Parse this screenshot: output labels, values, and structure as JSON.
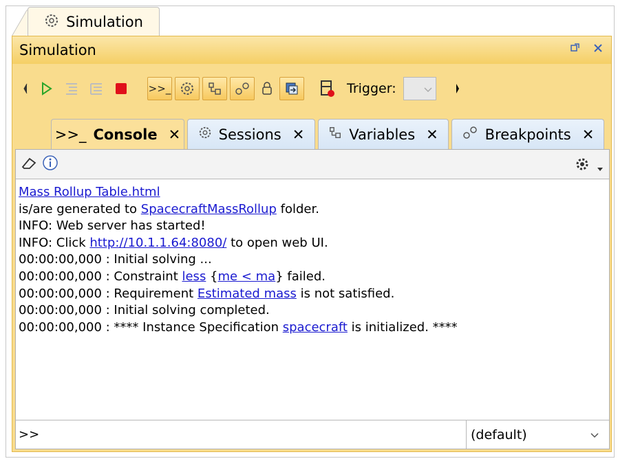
{
  "window": {
    "top_tab_label": "Simulation",
    "panel_title": "Simulation",
    "restore_icon": "restore-icon",
    "close_icon": "close-icon"
  },
  "toolbar": {
    "trigger_label": "Trigger:"
  },
  "tabs": [
    {
      "label": "Console",
      "prefix": ">>_",
      "active": true,
      "close": "✕"
    },
    {
      "label": "Sessions",
      "active": false,
      "close": "✕"
    },
    {
      "label": "Variables",
      "active": false,
      "close": "✕"
    },
    {
      "label": "Breakpoints",
      "active": false,
      "close": "✕"
    }
  ],
  "console": {
    "lines": [
      {
        "parts": [
          {
            "text": "Mass Rollup Table.html",
            "link": true
          }
        ]
      },
      {
        "parts": [
          {
            "text": "is/are generated to ",
            "link": false
          },
          {
            "text": "SpacecraftMassRollup",
            "link": true
          },
          {
            "text": " folder.",
            "link": false
          }
        ]
      },
      {
        "parts": [
          {
            "text": "INFO: Web server has started!",
            "link": false
          }
        ]
      },
      {
        "parts": [
          {
            "text": "INFO: Click ",
            "link": false
          },
          {
            "text": "http://10.1.1.64:8080/",
            "link": true
          },
          {
            "text": " to open web UI.",
            "link": false
          }
        ]
      },
      {
        "parts": [
          {
            "text": "00:00:00,000 : Initial solving ...",
            "link": false
          }
        ]
      },
      {
        "parts": [
          {
            "text": "00:00:00,000 : Constraint ",
            "link": false
          },
          {
            "text": "less",
            "link": true
          },
          {
            "text": " {",
            "link": false
          },
          {
            "text": "me < ma",
            "link": true
          },
          {
            "text": "} failed.",
            "link": false
          }
        ]
      },
      {
        "parts": [
          {
            "text": "00:00:00,000 : Requirement ",
            "link": false
          },
          {
            "text": "Estimated mass",
            "link": true
          },
          {
            "text": " is not satisfied.",
            "link": false
          }
        ]
      },
      {
        "parts": [
          {
            "text": "00:00:00,000 : Initial solving completed.",
            "link": false
          }
        ]
      },
      {
        "parts": [
          {
            "text": "00:00:00,000 : **** Instance Specification ",
            "link": false
          },
          {
            "text": "spacecraft",
            "link": true
          },
          {
            "text": " is initialized. ****",
            "link": false
          }
        ]
      }
    ]
  },
  "input": {
    "prompt": ">>",
    "context_value": "(default)"
  },
  "colors": {
    "panel": "#f9dc8d",
    "link": "#1a1ad0",
    "stop": "#e0101a",
    "play": "#2aa52a"
  }
}
